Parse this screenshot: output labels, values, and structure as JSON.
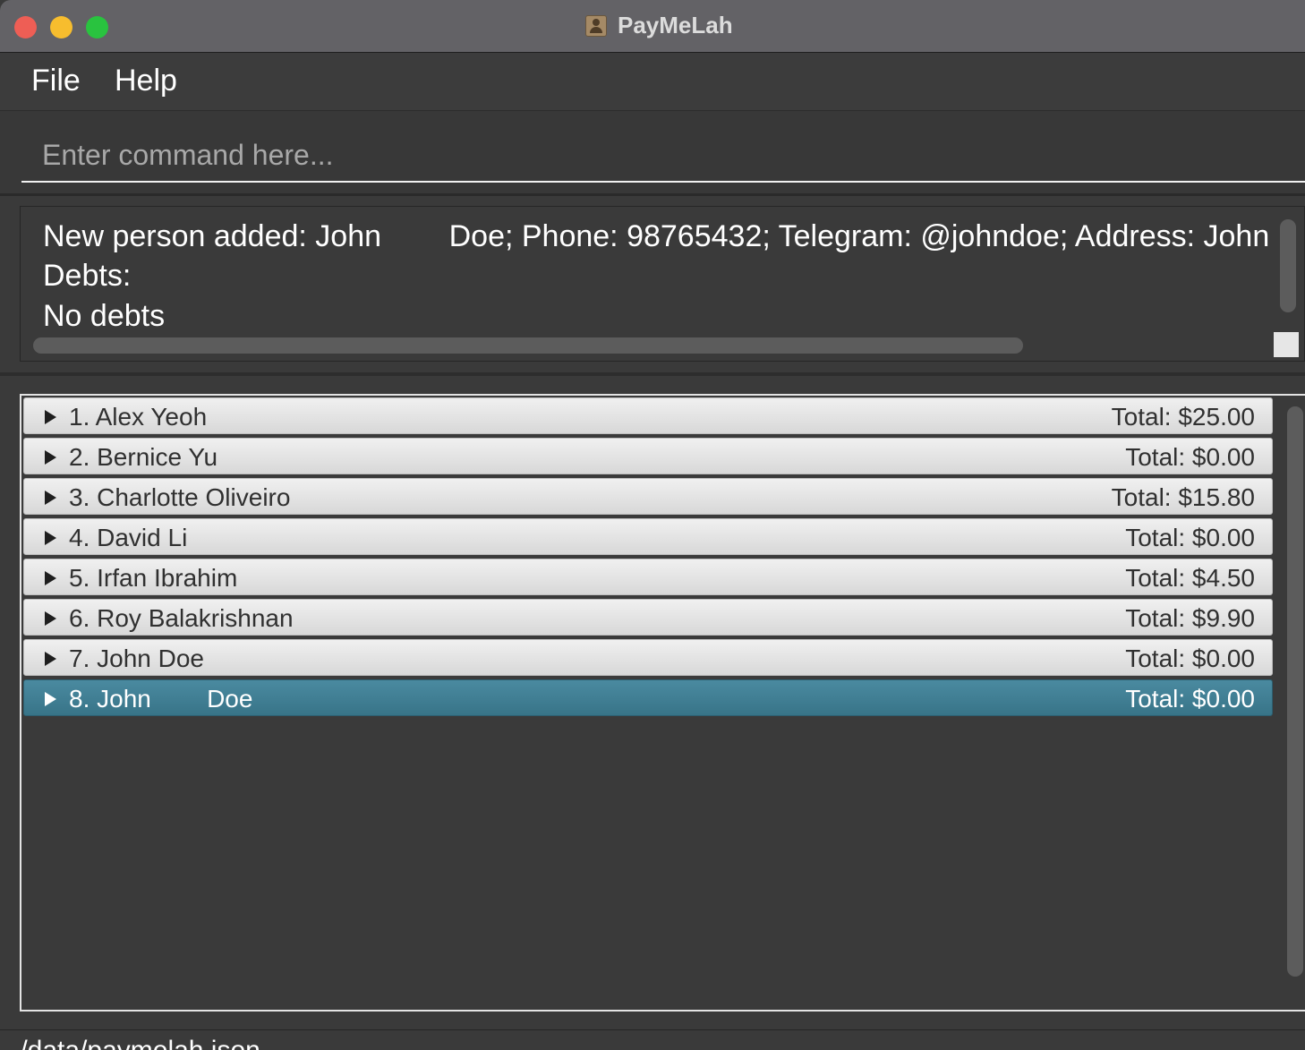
{
  "window": {
    "title": "PayMeLah"
  },
  "menu": {
    "file": "File",
    "help": "Help"
  },
  "command": {
    "placeholder": "Enter command here..."
  },
  "result": {
    "line1": "New person added: John        Doe; Phone: 98765432; Telegram: @johndoe; Address: John street",
    "line2": "Debts:",
    "line3": "No debts"
  },
  "persons": [
    {
      "label": "1. Alex Yeoh",
      "total": "Total: $25.00"
    },
    {
      "label": "2. Bernice Yu",
      "total": "Total: $0.00"
    },
    {
      "label": "3. Charlotte Oliveiro",
      "total": "Total: $15.80"
    },
    {
      "label": "4. David Li",
      "total": "Total: $0.00"
    },
    {
      "label": "5. Irfan Ibrahim",
      "total": "Total: $4.50"
    },
    {
      "label": "6. Roy Balakrishnan",
      "total": "Total: $9.90"
    },
    {
      "label": "7. John Doe",
      "total": "Total: $0.00"
    },
    {
      "label": "8. John        Doe",
      "total": "Total: $0.00"
    }
  ],
  "status": {
    "path": "./data/paymelah.json"
  },
  "colors": {
    "selected_row": "#3f7f94",
    "background": "#3a3a3a"
  }
}
